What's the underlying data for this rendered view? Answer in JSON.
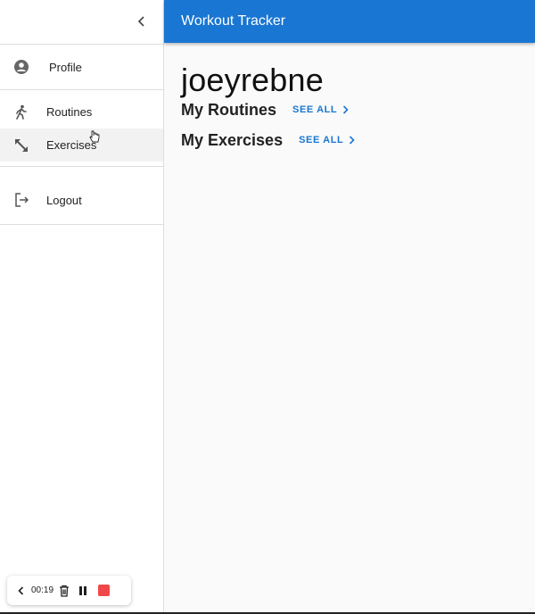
{
  "app": {
    "title": "Workout Tracker"
  },
  "sidebar": {
    "items": [
      {
        "label": "Profile",
        "icon": "account-circle-icon"
      },
      {
        "label": "Routines",
        "icon": "walking-person-icon"
      },
      {
        "label": "Exercises",
        "icon": "diagonal-arrows-icon"
      },
      {
        "label": "Logout",
        "icon": "logout-icon"
      }
    ]
  },
  "main": {
    "username": "joeyrebne",
    "sections": [
      {
        "title": "My Routines",
        "link": "SEE ALL"
      },
      {
        "title": "My Exercises",
        "link": "SEE ALL"
      }
    ]
  },
  "recorder": {
    "time": "00:19"
  },
  "colors": {
    "accent": "#1976d2",
    "record": "#f04848"
  }
}
